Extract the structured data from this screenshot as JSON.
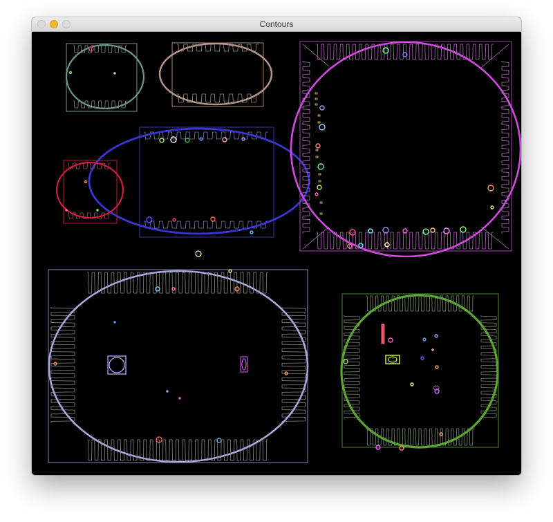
{
  "window": {
    "title": "Contours",
    "traffic_lights": {
      "close": "#dcdcdc",
      "minimize": "#f5b730",
      "zoom": "#dcdcdc"
    }
  },
  "canvas": {
    "background": "#000000",
    "objects": [
      {
        "name": "top-left-chip",
        "ellipse_color": "#6f9a8a",
        "rect_color": "#6f9a8a",
        "pad_color": "#7f8f8a"
      },
      {
        "name": "top-middle-chip",
        "ellipse_color": "#b7968a",
        "rect_color": "#a08a70",
        "pad_color": "#9a8c82"
      },
      {
        "name": "center-blue-chip",
        "ellipse_color": "#3b35d6",
        "rect_color": "#3b35b0",
        "pad_color": "#7a78b0"
      },
      {
        "name": "left-red-chip",
        "ellipse_color": "#d21d3c",
        "rect_color": "#b5203a",
        "pad_color": "#a05060"
      },
      {
        "name": "right-magenta-chip",
        "ellipse_color": "#d24be0",
        "rect_color": "#a845b0",
        "pad_color": "#b070b8"
      },
      {
        "name": "bottom-left-chip",
        "ellipse_color": "#a9a6d8",
        "rect_color": "#8a88b0",
        "pad_color": "#8c8c8c"
      },
      {
        "name": "bottom-right-chip",
        "ellipse_color": "#5aa632",
        "rect_color": "#4e8a2e",
        "pad_color": "#7a8a6a"
      }
    ]
  }
}
